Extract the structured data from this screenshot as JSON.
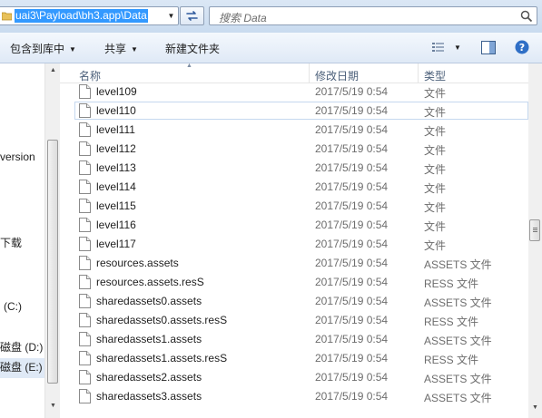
{
  "address": {
    "path": "uai3\\Payload\\bh3.app\\Data"
  },
  "search": {
    "placeholder": "搜索 Data"
  },
  "toolbar": {
    "include_in_library": "包含到库中",
    "share": "共享",
    "new_folder": "新建文件夹"
  },
  "nav": {
    "items": [
      "version",
      "下载",
      "(C:)",
      "磁盘 (D:)",
      "磁盘 (E:)"
    ]
  },
  "columns": {
    "name": "名称",
    "modified": "修改日期",
    "type": "类型"
  },
  "files": [
    {
      "name": "level109",
      "date": "2017/5/19 0:54",
      "type": "文件"
    },
    {
      "name": "level110",
      "date": "2017/5/19 0:54",
      "type": "文件"
    },
    {
      "name": "level111",
      "date": "2017/5/19 0:54",
      "type": "文件"
    },
    {
      "name": "level112",
      "date": "2017/5/19 0:54",
      "type": "文件"
    },
    {
      "name": "level113",
      "date": "2017/5/19 0:54",
      "type": "文件"
    },
    {
      "name": "level114",
      "date": "2017/5/19 0:54",
      "type": "文件"
    },
    {
      "name": "level115",
      "date": "2017/5/19 0:54",
      "type": "文件"
    },
    {
      "name": "level116",
      "date": "2017/5/19 0:54",
      "type": "文件"
    },
    {
      "name": "level117",
      "date": "2017/5/19 0:54",
      "type": "文件"
    },
    {
      "name": "resources.assets",
      "date": "2017/5/19 0:54",
      "type": "ASSETS 文件"
    },
    {
      "name": "resources.assets.resS",
      "date": "2017/5/19 0:54",
      "type": "RESS 文件"
    },
    {
      "name": "sharedassets0.assets",
      "date": "2017/5/19 0:54",
      "type": "ASSETS 文件"
    },
    {
      "name": "sharedassets0.assets.resS",
      "date": "2017/5/19 0:54",
      "type": "RESS 文件"
    },
    {
      "name": "sharedassets1.assets",
      "date": "2017/5/19 0:54",
      "type": "ASSETS 文件"
    },
    {
      "name": "sharedassets1.assets.resS",
      "date": "2017/5/19 0:54",
      "type": "RESS 文件"
    },
    {
      "name": "sharedassets2.assets",
      "date": "2017/5/19 0:54",
      "type": "ASSETS 文件"
    },
    {
      "name": "sharedassets3.assets",
      "date": "2017/5/19 0:54",
      "type": "ASSETS 文件"
    }
  ],
  "hovered_file": "level110",
  "icons": {
    "folder": "folder-icon",
    "refresh": "refresh-icon",
    "search": "search-icon",
    "view": "view-options-icon",
    "preview_pane": "preview-pane-icon",
    "help": "help-icon",
    "file": "file-icon"
  }
}
